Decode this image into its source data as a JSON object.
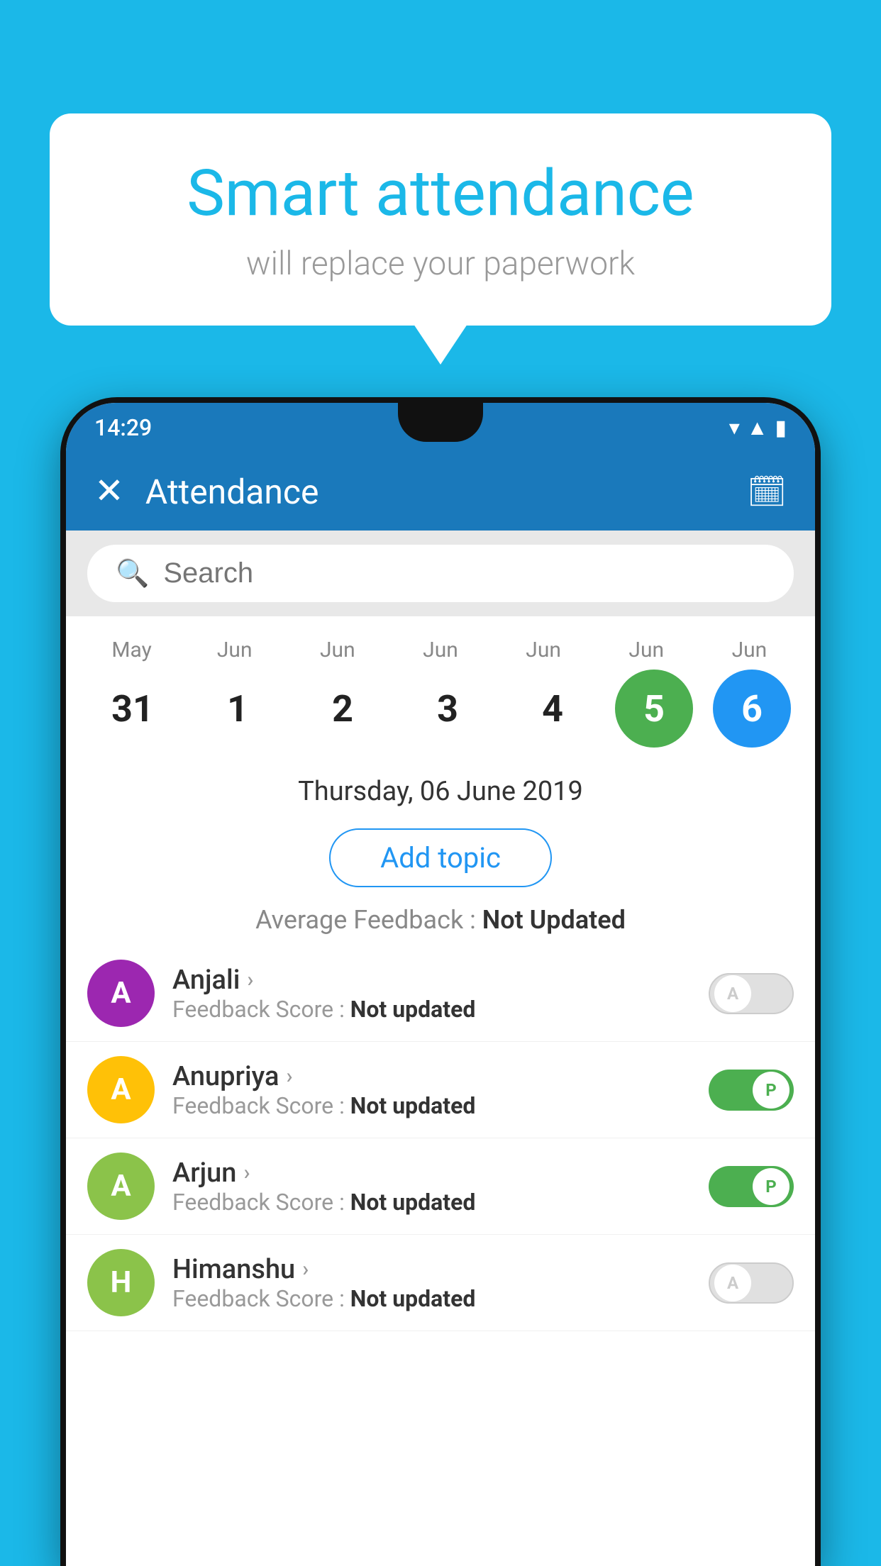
{
  "background_color": "#1BB8E8",
  "speech_bubble": {
    "title": "Smart attendance",
    "subtitle": "will replace your paperwork"
  },
  "status_bar": {
    "time": "14:29"
  },
  "app_bar": {
    "title": "Attendance",
    "close_label": "✕",
    "calendar_label": "📅"
  },
  "search": {
    "placeholder": "Search"
  },
  "calendar": {
    "months": [
      "May",
      "Jun",
      "Jun",
      "Jun",
      "Jun",
      "Jun",
      "Jun"
    ],
    "days": [
      "31",
      "1",
      "2",
      "3",
      "4",
      "5",
      "6"
    ],
    "selected_green_index": 5,
    "selected_blue_index": 6
  },
  "selected_date": "Thursday, 06 June 2019",
  "add_topic_label": "Add topic",
  "average_feedback": {
    "label": "Average Feedback : ",
    "value": "Not Updated"
  },
  "students": [
    {
      "name": "Anjali",
      "avatar_letter": "A",
      "avatar_color": "#9C27B0",
      "feedback_label": "Feedback Score : ",
      "feedback_value": "Not updated",
      "toggle_state": "off",
      "toggle_label": "A"
    },
    {
      "name": "Anupriya",
      "avatar_letter": "A",
      "avatar_color": "#FFC107",
      "feedback_label": "Feedback Score : ",
      "feedback_value": "Not updated",
      "toggle_state": "on",
      "toggle_label": "P"
    },
    {
      "name": "Arjun",
      "avatar_letter": "A",
      "avatar_color": "#8BC34A",
      "feedback_label": "Feedback Score : ",
      "feedback_value": "Not updated",
      "toggle_state": "on",
      "toggle_label": "P"
    },
    {
      "name": "Himanshu",
      "avatar_letter": "H",
      "avatar_color": "#8BC34A",
      "feedback_label": "Feedback Score : ",
      "feedback_value": "Not updated",
      "toggle_state": "off",
      "toggle_label": "A"
    }
  ]
}
